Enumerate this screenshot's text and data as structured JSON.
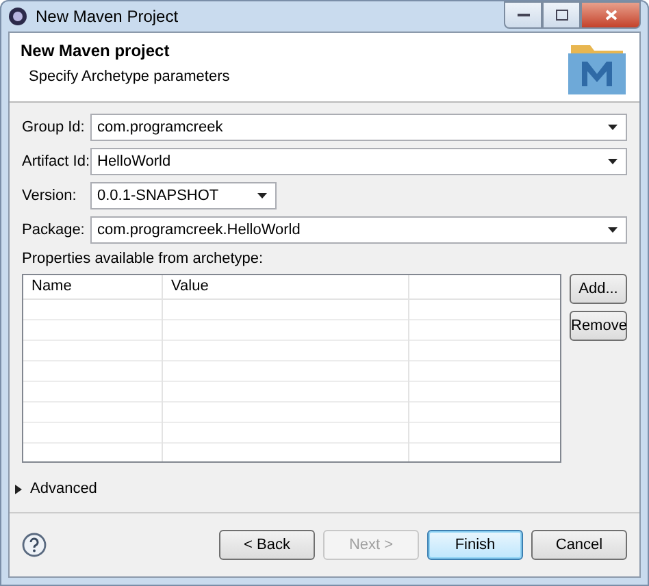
{
  "window": {
    "title": "New Maven Project"
  },
  "header": {
    "title": "New Maven project",
    "subtitle": "Specify Archetype parameters"
  },
  "fields": [
    {
      "label": "Group Id:",
      "value": "com.programcreek",
      "wide": true
    },
    {
      "label": "Artifact Id:",
      "value": "HelloWorld",
      "wide": true
    },
    {
      "label": "Version:",
      "value": "0.0.1-SNAPSHOT",
      "wide": false
    },
    {
      "label": "Package:",
      "value": "com.programcreek.HelloWorld",
      "wide": true
    }
  ],
  "properties": {
    "label": "Properties available from archetype:",
    "columns": [
      "Name",
      "Value"
    ],
    "buttons": [
      "Add...",
      "Remove"
    ]
  },
  "advanced": {
    "label": "Advanced",
    "expanded": false
  },
  "buttons": [
    {
      "label": "< Back",
      "disabled": false,
      "default": false
    },
    {
      "label": "Next >",
      "disabled": true,
      "default": false
    },
    {
      "label": "Finish",
      "disabled": false,
      "default": true
    },
    {
      "label": "Cancel",
      "disabled": false,
      "default": false
    }
  ]
}
